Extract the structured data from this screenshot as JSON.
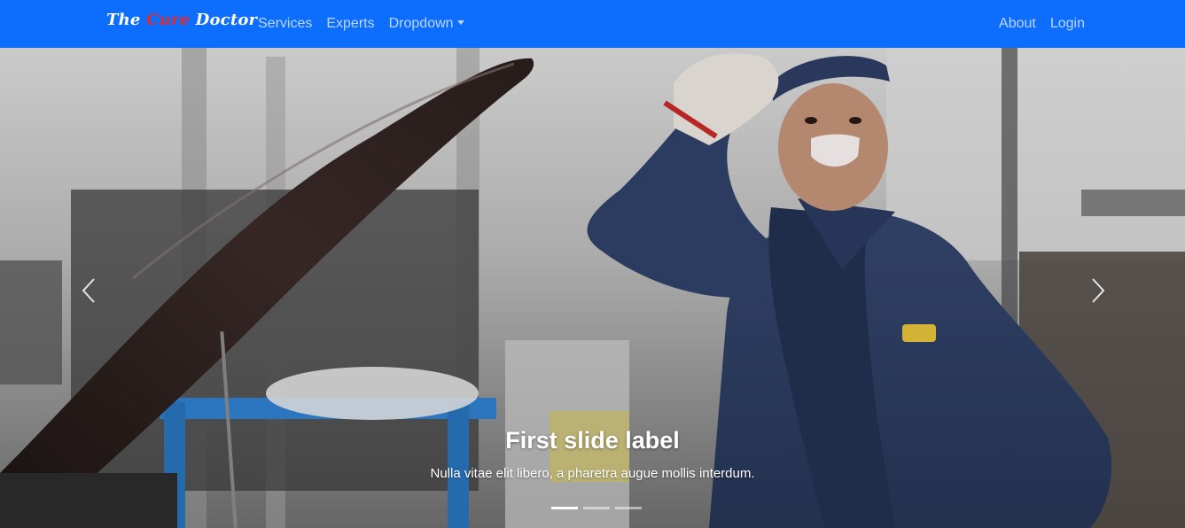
{
  "navbar": {
    "brand": {
      "part1": "The ",
      "part2": "Cure",
      "part3": " Doctor"
    },
    "left_links": [
      "Services",
      "Experts",
      "Dropdown"
    ],
    "right_links": [
      "About",
      "Login"
    ],
    "colors": {
      "background": "#0d6efd",
      "brand_accent": "#e0282f"
    }
  },
  "carousel": {
    "caption_title": "First slide label",
    "caption_text": "Nulla vitae elit libero, a pharetra augue mollis interdum.",
    "controls": {
      "prev_icon": "chevron-left-icon",
      "next_icon": "chevron-right-icon"
    },
    "indicators": {
      "count": 3,
      "active_index": 0
    },
    "image": "mechanic-smiling-beside-open-car-hood"
  }
}
